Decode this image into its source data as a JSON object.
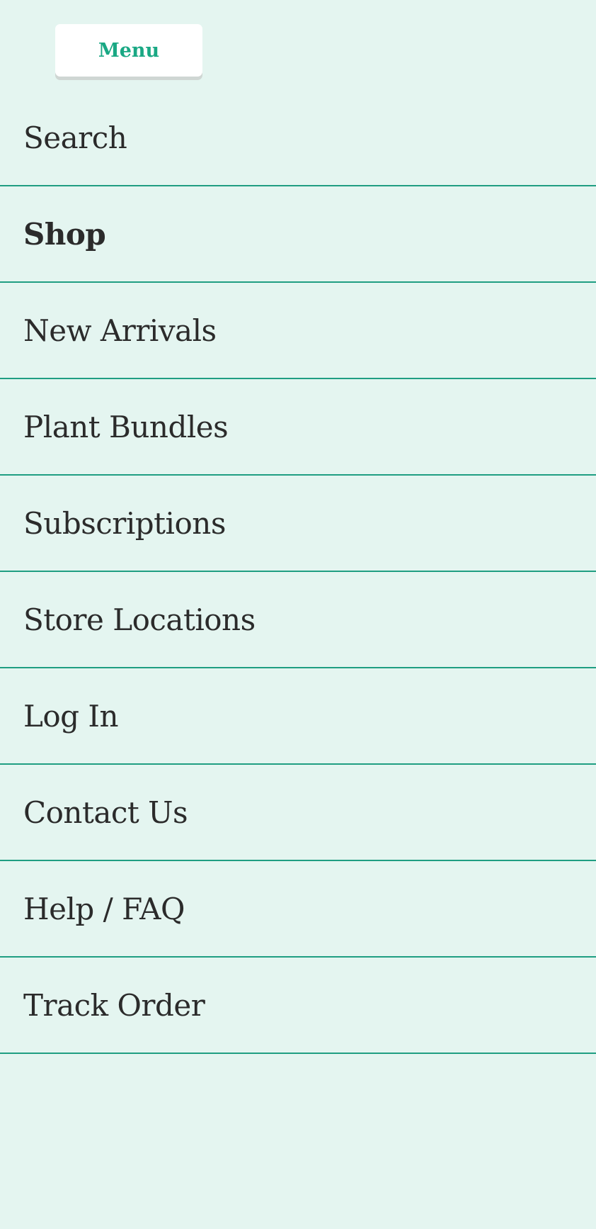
{
  "header": {
    "menu_label": "Menu",
    "accent_color": "#1aa884"
  },
  "nav": {
    "items": [
      {
        "label": "Search",
        "bold": false
      },
      {
        "label": "Shop",
        "bold": true
      },
      {
        "label": "New Arrivals",
        "bold": false
      },
      {
        "label": "Plant Bundles",
        "bold": false
      },
      {
        "label": "Subscriptions",
        "bold": false
      },
      {
        "label": "Store Locations",
        "bold": false
      },
      {
        "label": "Log In",
        "bold": false
      },
      {
        "label": "Contact Us",
        "bold": false
      },
      {
        "label": "Help / FAQ",
        "bold": false
      },
      {
        "label": "Track Order",
        "bold": false
      }
    ]
  }
}
